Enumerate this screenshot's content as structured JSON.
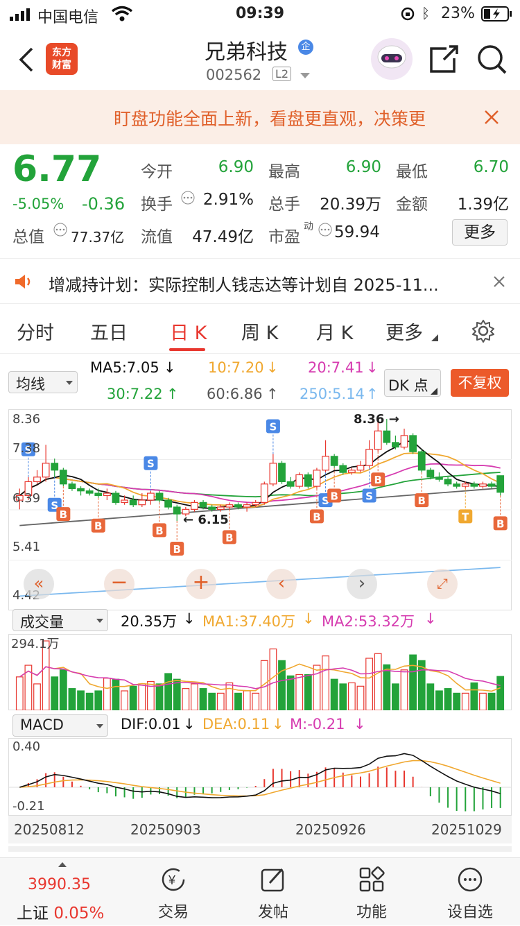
{
  "status": {
    "carrier": "中国电信",
    "time": "09:39",
    "battery": "23%"
  },
  "header": {
    "back_icon": "chevron-left-icon",
    "logo_line1": "东方",
    "logo_line2": "财富",
    "stock_name": "兄弟科技",
    "enterprise_badge": "企",
    "stock_code": "002562",
    "level": "L2"
  },
  "banner": {
    "text": "盯盘功能全面上新，看盘更直观，决策更"
  },
  "quote": {
    "price": "6.77",
    "change_pct": "-5.05%",
    "change": "-0.36",
    "open_label": "今开",
    "open": "6.90",
    "high_label": "最高",
    "high": "6.90",
    "low_label": "最低",
    "low": "6.70",
    "turnover_label": "换手",
    "turnover": "2.91%",
    "volume_label": "总手",
    "volume": "20.39万",
    "amount_label": "金额",
    "amount": "1.39亿",
    "mcap_label": "总值",
    "mcap": "77.37亿",
    "float_label": "流值",
    "float_mcap": "47.49亿",
    "pe_label": "市盈",
    "pe_sup": "动",
    "pe": "59.94",
    "more_button": "更多"
  },
  "notice": {
    "text": "增减持计划：实际控制人钱志达等计划自 2025-11..."
  },
  "tabs": [
    "分时",
    "五日",
    "日 K",
    "周 K",
    "月 K",
    "更多"
  ],
  "kline": {
    "indicator_select": "均线",
    "ma5": "MA5:7.05",
    "ma10": "10:7.20",
    "ma20": "20:7.41",
    "ma30": "30:7.22",
    "ma60": "60:6.86",
    "ma250": "250:5.14",
    "dk_button": "DK 点",
    "adjust_button": "不复权",
    "y_max": "8.36",
    "y_2": "7.38",
    "y_3": "6.39",
    "y_4": "5.41",
    "y_min": "4.42",
    "high_marker": "8.36",
    "low_marker": "6.15",
    "colors": {
      "ma5": "#111111",
      "ma10": "#f0a830",
      "ma20": "#d63cb0",
      "ma30": "#23a33a",
      "ma60": "#666666",
      "ma250": "#7ab8ee",
      "up": "#e8372f",
      "down": "#23a33a"
    }
  },
  "volume": {
    "indicator_select": "成交量",
    "current": "20.35万",
    "ma1": "MA1:37.40万",
    "ma2": "MA2:53.32万",
    "y_max": "294.1万"
  },
  "macd": {
    "indicator_select": "MACD",
    "dif": "DIF:0.01",
    "dea": "DEA:0.11",
    "m": "M:-0.21",
    "y_max": "0.40",
    "y_min": "-0.21"
  },
  "dates": [
    "20250812",
    "20250903",
    "20250926",
    "20251029"
  ],
  "chart_data": {
    "type": "candlestick",
    "dates_shown": [
      "20250812",
      "20250903",
      "20250926",
      "20251029"
    ],
    "y_range": [
      4.42,
      8.36
    ],
    "candles": [
      [
        6.6,
        6.7,
        6.4,
        6.85
      ],
      [
        6.7,
        7.0,
        6.6,
        7.1
      ],
      [
        7.0,
        7.1,
        6.95,
        7.25
      ],
      [
        7.1,
        7.4,
        7.0,
        7.8
      ],
      [
        7.4,
        7.25,
        7.1,
        7.5
      ],
      [
        7.25,
        6.95,
        6.9,
        7.3
      ],
      [
        6.95,
        6.85,
        6.8,
        7.0
      ],
      [
        6.85,
        6.8,
        6.7,
        6.9
      ],
      [
        6.8,
        6.75,
        6.7,
        6.85
      ],
      [
        6.75,
        6.7,
        6.65,
        6.85
      ],
      [
        6.7,
        6.75,
        6.6,
        6.85
      ],
      [
        6.75,
        6.55,
        6.5,
        6.8
      ],
      [
        6.55,
        6.6,
        6.5,
        6.7
      ],
      [
        6.6,
        6.5,
        6.45,
        6.7
      ],
      [
        6.5,
        6.6,
        6.45,
        6.75
      ],
      [
        6.6,
        6.75,
        6.5,
        6.8
      ],
      [
        6.75,
        6.6,
        6.55,
        6.8
      ],
      [
        6.6,
        6.45,
        6.4,
        6.65
      ],
      [
        6.45,
        6.3,
        6.15,
        6.5
      ],
      [
        6.3,
        6.4,
        6.25,
        6.45
      ],
      [
        6.4,
        6.55,
        6.35,
        6.6
      ],
      [
        6.55,
        6.45,
        6.4,
        6.6
      ],
      [
        6.45,
        6.4,
        6.35,
        6.5
      ],
      [
        6.4,
        6.45,
        6.35,
        6.5
      ],
      [
        6.45,
        6.5,
        6.4,
        6.55
      ],
      [
        6.5,
        6.45,
        6.4,
        6.55
      ],
      [
        6.45,
        6.5,
        6.35,
        6.55
      ],
      [
        6.5,
        6.55,
        6.45,
        6.6
      ],
      [
        6.55,
        6.95,
        6.5,
        7.0
      ],
      [
        6.95,
        7.4,
        6.9,
        7.6
      ],
      [
        7.4,
        7.0,
        6.95,
        7.45
      ],
      [
        7.0,
        6.9,
        6.85,
        7.1
      ],
      [
        6.9,
        7.15,
        6.85,
        7.2
      ],
      [
        7.15,
        6.9,
        6.85,
        7.2
      ],
      [
        6.9,
        7.25,
        6.85,
        7.3
      ],
      [
        7.25,
        7.55,
        7.2,
        7.9
      ],
      [
        7.55,
        7.35,
        7.3,
        7.6
      ],
      [
        7.35,
        7.2,
        7.15,
        7.4
      ],
      [
        7.2,
        7.25,
        7.15,
        7.3
      ],
      [
        7.25,
        7.35,
        7.2,
        7.45
      ],
      [
        7.35,
        7.7,
        7.3,
        7.9
      ],
      [
        7.7,
        8.1,
        7.65,
        8.3
      ],
      [
        8.1,
        7.85,
        7.8,
        8.36
      ],
      [
        7.85,
        7.75,
        7.7,
        8.0
      ],
      [
        7.75,
        8.0,
        7.7,
        8.15
      ],
      [
        8.0,
        7.65,
        7.6,
        8.05
      ],
      [
        7.65,
        7.25,
        7.2,
        7.7
      ],
      [
        7.25,
        7.1,
        7.05,
        7.3
      ],
      [
        7.1,
        7.05,
        7.0,
        7.2
      ],
      [
        7.05,
        6.95,
        6.9,
        7.1
      ],
      [
        6.95,
        6.9,
        6.85,
        7.0
      ],
      [
        6.9,
        6.95,
        6.85,
        7.0
      ],
      [
        6.95,
        6.9,
        6.85,
        7.0
      ],
      [
        6.9,
        6.95,
        6.85,
        7.0
      ],
      [
        6.95,
        6.9,
        6.85,
        7.0
      ],
      [
        7.13,
        6.77,
        6.7,
        6.9
      ]
    ]
  }
}
